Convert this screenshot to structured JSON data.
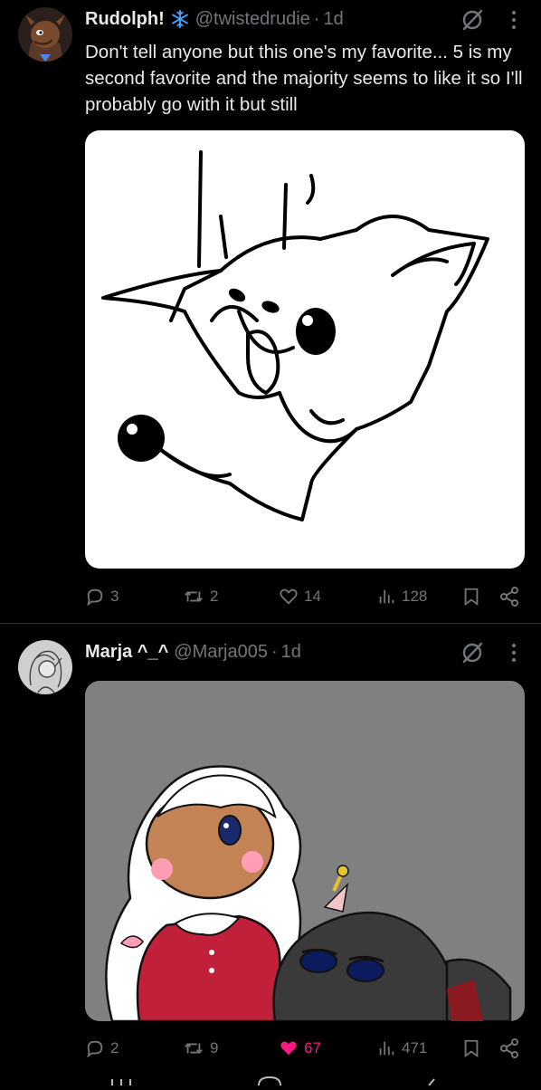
{
  "posts": [
    {
      "author": {
        "display_name": "Rudolph!",
        "handle": "@twistedrudie",
        "badge_icon": "snowflake-icon"
      },
      "separator": "·",
      "time": "1d",
      "text": "Don't tell anyone but this one's my favorite... 5 is my second favorite and the majority seems to like it so I'll probably go with it but still",
      "stats": {
        "replies": "3",
        "reposts": "2",
        "likes": "14",
        "views": "128"
      },
      "liked": false,
      "media_icon": "reindeer-sketch-image"
    },
    {
      "author": {
        "display_name": "Marja ^_^",
        "handle": "@Marja005"
      },
      "separator": "·",
      "time": "1d",
      "text": "",
      "stats": {
        "replies": "2",
        "reposts": "9",
        "likes": "67",
        "views": "471"
      },
      "liked": true,
      "media_icon": "character-artwork-image"
    }
  ],
  "colors": {
    "background": "#000000",
    "text": "#e7e9ea",
    "muted": "#71767b",
    "like_active": "#f91880",
    "divider": "#2f3336",
    "snowflake": "#4aa3ff"
  }
}
